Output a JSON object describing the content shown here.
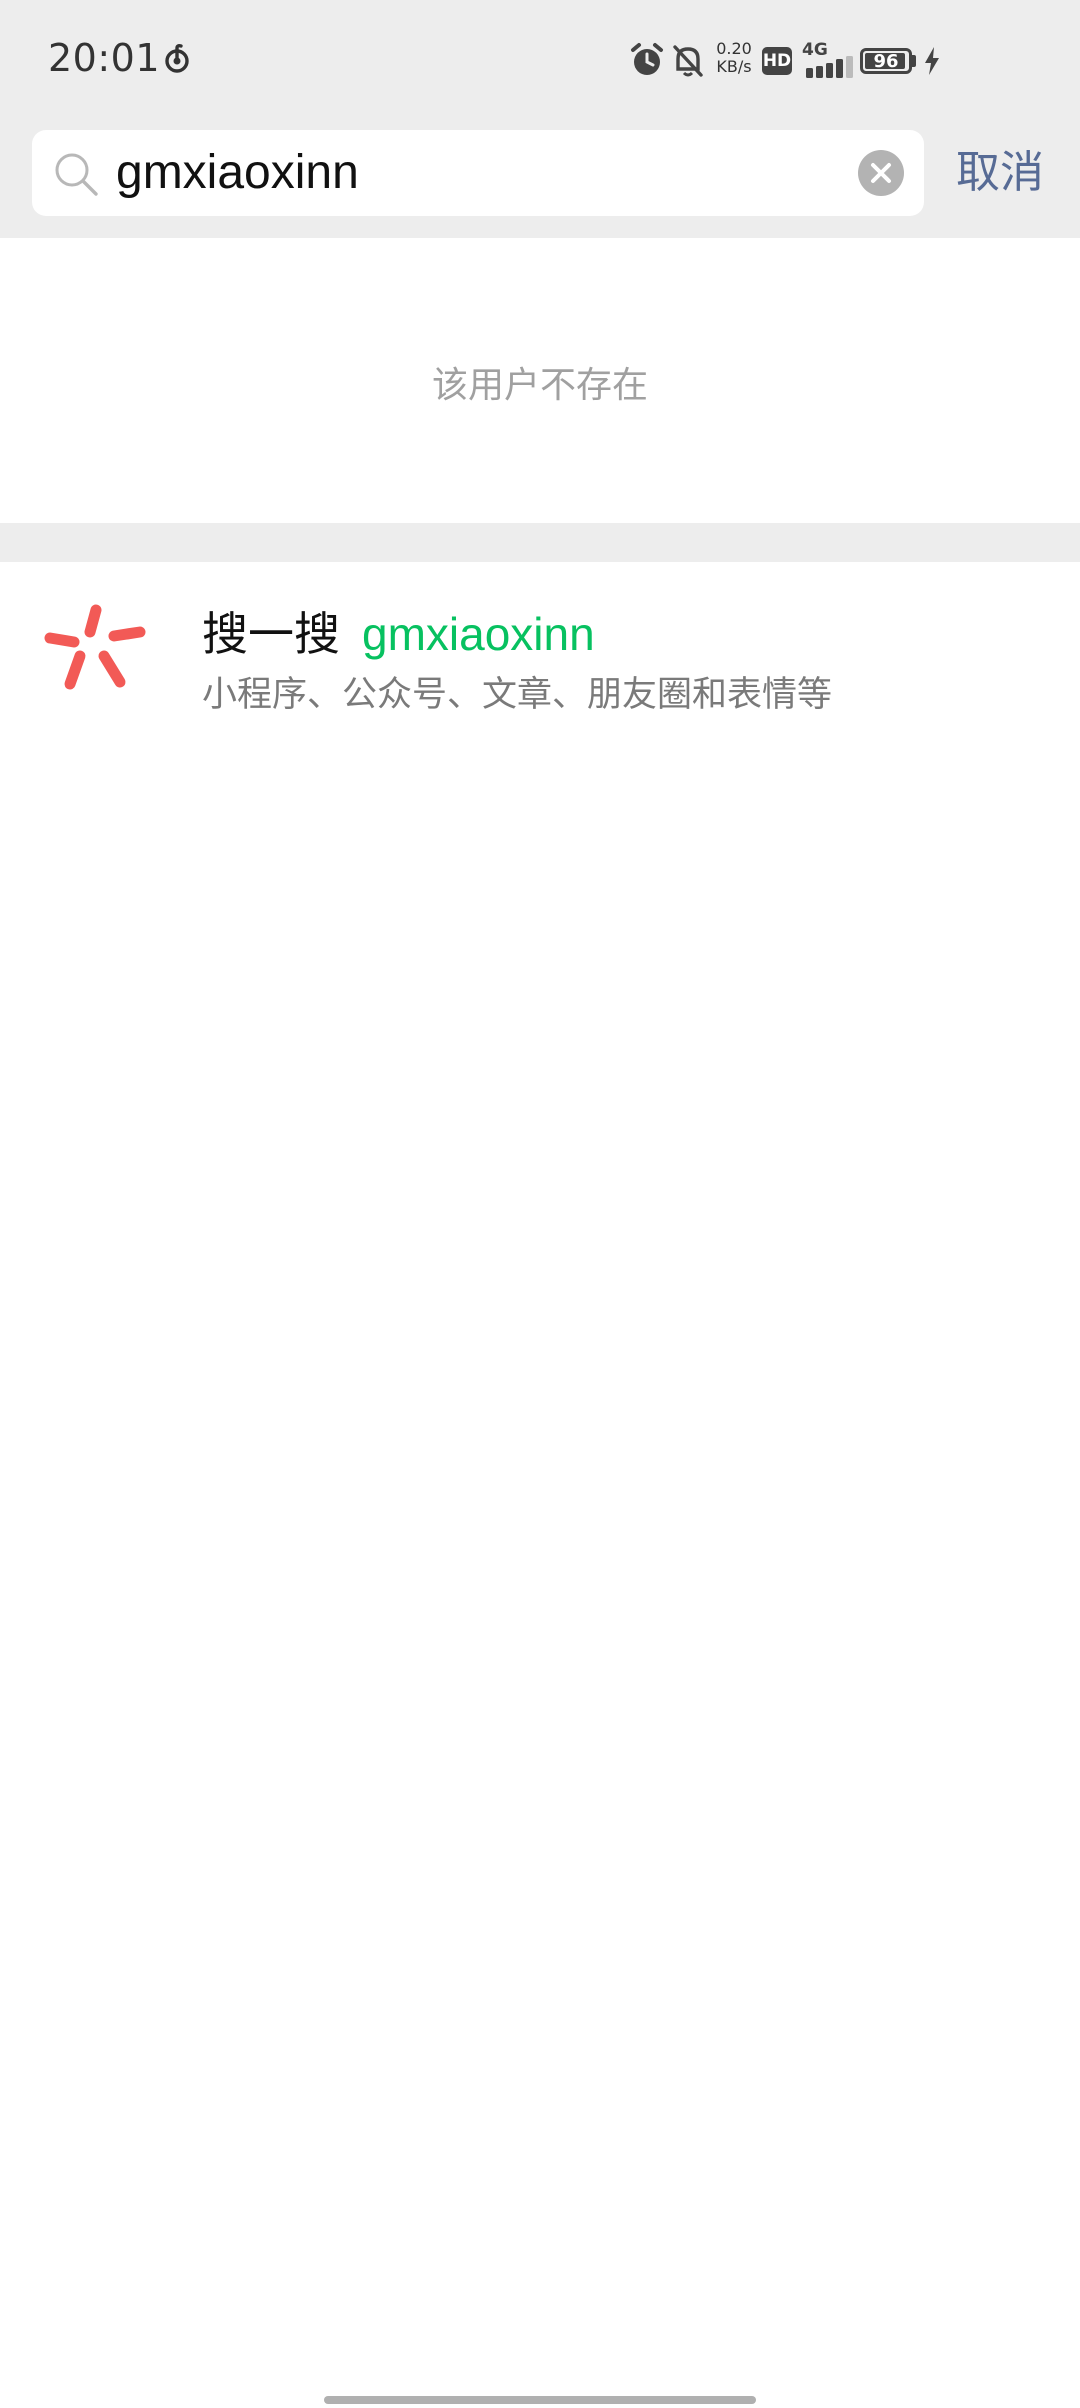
{
  "status_bar": {
    "time": "20:01",
    "net_speed_value": "0.20",
    "net_speed_unit": "KB/s",
    "hd_label": "HD",
    "network_label": "4G",
    "battery_level": "96",
    "battery_fraction": 0.96,
    "icons": [
      "netease-music-icon",
      "alarm-icon",
      "bell-off-icon",
      "signal-icon",
      "battery-icon",
      "charging-bolt-icon"
    ]
  },
  "search": {
    "query": "gmxiaoxinn",
    "cancel_label": "取消"
  },
  "no_user": {
    "message": "该用户不存在"
  },
  "result": {
    "title": "搜一搜",
    "keyword": "gmxiaoxinn",
    "subtitle": "小程序、公众号、文章、朋友圈和表情等"
  },
  "colors": {
    "accent_green": "#07c160",
    "cancel_blue": "#576b95",
    "sousou_red": "#f25a56"
  }
}
